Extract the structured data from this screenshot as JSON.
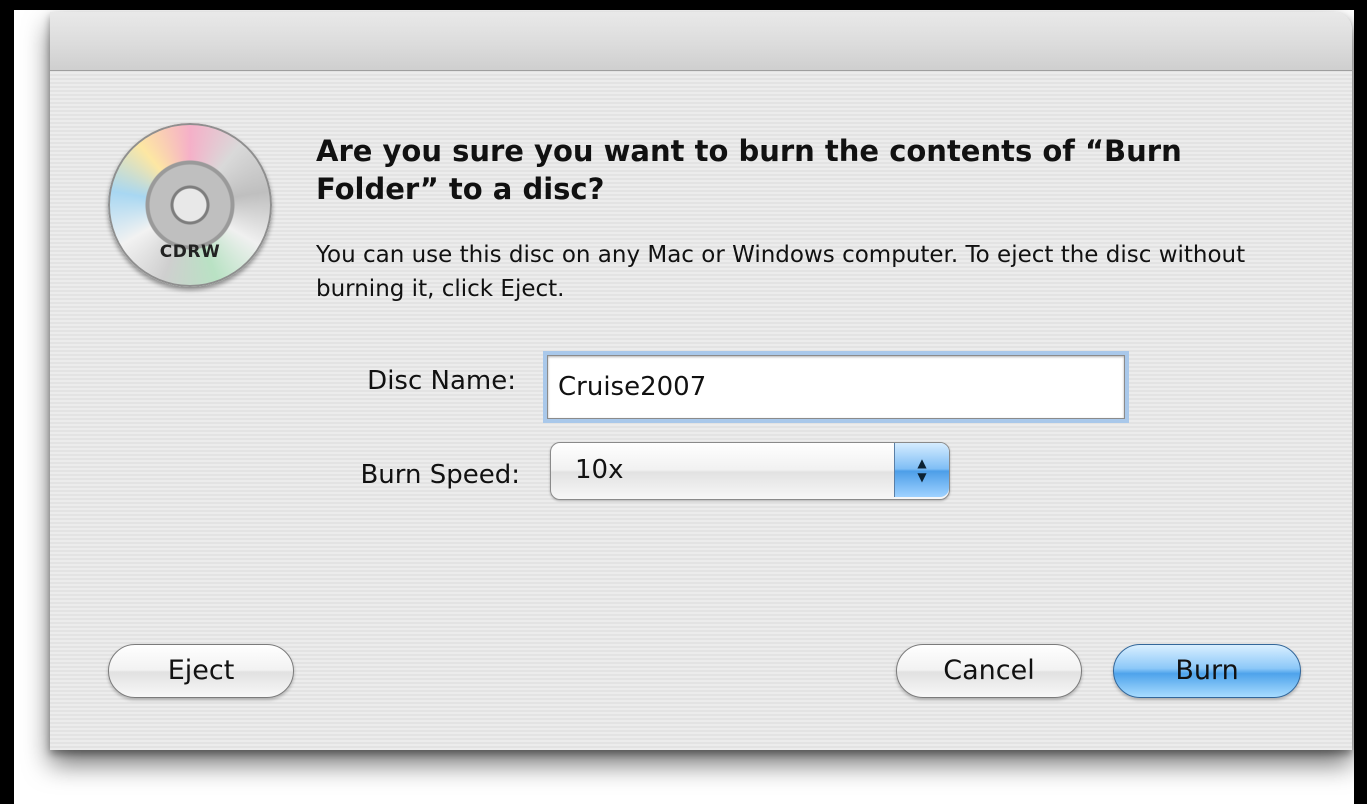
{
  "dialog": {
    "heading": "Are you sure you want to burn the contents of “Burn Folder” to a disc?",
    "info": "You can use this disc on any Mac or Windows computer. To eject the disc without burning it, click Eject.",
    "disc_icon_label": "CDRW",
    "disc_icon": "cdrw-disc-icon"
  },
  "form": {
    "disc_name_label": "Disc Name:",
    "disc_name_value": "Cruise2007",
    "burn_speed_label": "Burn Speed:",
    "burn_speed_value": "10x"
  },
  "buttons": {
    "eject": "Eject",
    "cancel": "Cancel",
    "burn": "Burn"
  },
  "colors": {
    "default_button": "#6fb3f2",
    "focus_ring": "#a9c8ea"
  }
}
